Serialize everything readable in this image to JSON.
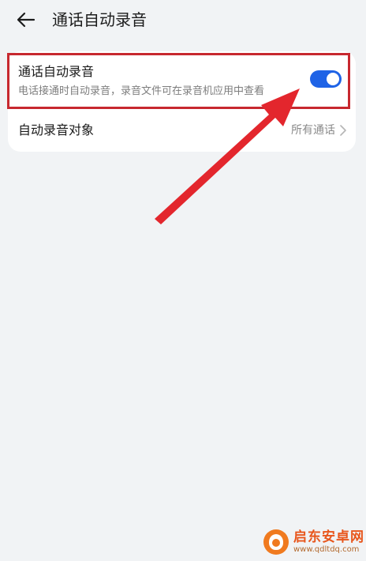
{
  "header": {
    "title": "通话自动录音"
  },
  "settings": {
    "auto_record": {
      "title": "通话自动录音",
      "subtitle": "电话接通时自动录音，录音文件可在录音机应用中查看",
      "enabled": true
    },
    "record_target": {
      "label": "自动录音对象",
      "value": "所有通话"
    }
  },
  "colors": {
    "toggle_on": "#1f63e6",
    "highlight": "#c7282f",
    "arrow": "#e3262d",
    "background": "#f1f3f5"
  },
  "icons": {
    "back": "arrow-left-icon",
    "chevron": "chevron-right-icon"
  },
  "watermark": {
    "name": "启东安卓网",
    "url": "www.qdltdq.com"
  }
}
